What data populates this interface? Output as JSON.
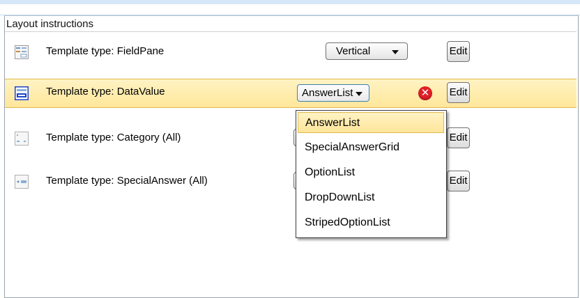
{
  "panel": {
    "title": "Layout instructions"
  },
  "rows": [
    {
      "label": "Template type: FieldPane",
      "combo": "Vertical",
      "edit": "Edit",
      "icon": "fieldpane-template-icon"
    },
    {
      "label": "Template type: DataValue",
      "combo": "AnswerList",
      "edit": "Edit",
      "icon": "datavalue-template-icon",
      "selected": true
    },
    {
      "label": "Template type: Category (All)",
      "combo": "",
      "edit": "Edit",
      "icon": "category-template-icon"
    },
    {
      "label": "Template type: SpecialAnswer (All)",
      "combo": "",
      "edit": "Edit",
      "icon": "specialanswer-template-icon"
    }
  ],
  "dropdown": {
    "options": [
      "AnswerList",
      "SpecialAnswerGrid",
      "OptionList",
      "DropDownList",
      "StripedOptionList"
    ],
    "highlighted": "AnswerList"
  },
  "icons": {
    "clear": "clear-icon",
    "arrow": "dropdown-arrow-icon"
  },
  "colors": {
    "selection": "#ffe79a",
    "selection_border": "#e0b94d",
    "clear_red": "#e01f27"
  }
}
